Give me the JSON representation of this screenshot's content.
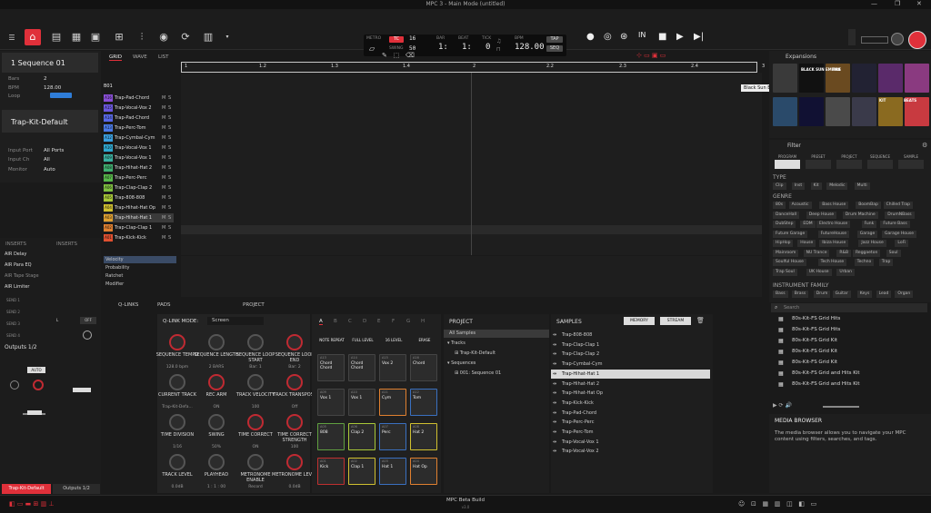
{
  "window": {
    "title": "MPC 3 - Main Mode (untitled)",
    "status": "MPC Beta Build",
    "status_sub": "v3.0"
  },
  "transport": {
    "metro_label": "METRO",
    "tc_label": "TC",
    "tc_value": "16",
    "swing_label": "SWING",
    "swing_value": "50",
    "bar_label": "BAR",
    "bar_value": "1:",
    "beat_label": "BEAT",
    "beat_value": "1:",
    "tick_label": "TICK",
    "tick_value": "0",
    "bpm_label": "BPM",
    "bpm_value": "128.00",
    "tap_label": "TAP",
    "seq_label": "SEQ"
  },
  "sequence": {
    "name": "1 Sequence 01",
    "bars_label": "Bars",
    "bars_value": "2",
    "bpm_label": "BPM",
    "bpm_value": "128.00",
    "loop_label": "Loop"
  },
  "track": {
    "name": "Trap-Kit-Default",
    "input_port_label": "Input Port",
    "input_port_value": "All Ports",
    "input_ch_label": "Input Ch",
    "input_ch_value": "All",
    "monitor_label": "Monitor",
    "monitor_value": "Auto"
  },
  "inserts": {
    "header_left": "INSERTS",
    "header_right": "INSERTS",
    "slots": [
      "AIR Delay",
      "AIR Para EQ",
      "AIR Tape Stage",
      "AIR Limiter"
    ],
    "sends": [
      "SEND 1",
      "SEND 2",
      "SEND 3",
      "SEND 4"
    ],
    "outputs": "Outputs 1/2",
    "auto": "AUTO",
    "bottom_left": "Trap-Kit-Default",
    "bottom_right": "Outputs 1/2"
  },
  "grid_tabs": [
    "GRID",
    "WAVE",
    "LIST"
  ],
  "grid_header_row": "B01",
  "tracks": [
    {
      "pad": "A16",
      "name": "Trap-Pad-Chord",
      "color": "#8a4fd8"
    },
    {
      "pad": "A15",
      "name": "Trap-Vocal-Vox 2",
      "color": "#6c58e0"
    },
    {
      "pad": "A14",
      "name": "Trap-Pad-Chord",
      "color": "#5868e8"
    },
    {
      "pad": "A13",
      "name": "Trap-Perc-Tom",
      "color": "#4a7ae8"
    },
    {
      "pad": "A12",
      "name": "Trap-Cymbal-Cym",
      "color": "#3aa0e0"
    },
    {
      "pad": "A10",
      "name": "Trap-Vocal-Vox 1",
      "color": "#2fa8d0"
    },
    {
      "pad": "A09",
      "name": "Trap-Vocal-Vox 1",
      "color": "#3ab0a0"
    },
    {
      "pad": "A08",
      "name": "Trap-Hihat-Hat 2",
      "color": "#40b070"
    },
    {
      "pad": "A07",
      "name": "Trap-Perc-Perc",
      "color": "#58b84a"
    },
    {
      "pad": "A06",
      "name": "Trap-Clap-Clap 2",
      "color": "#80c040"
    },
    {
      "pad": "A05",
      "name": "Trap-808-808",
      "color": "#a8c838"
    },
    {
      "pad": "A04",
      "name": "Trap-Hihat-Hat Op",
      "color": "#d0c030"
    },
    {
      "pad": "A03",
      "name": "Trap-Hihat-Hat 1",
      "color": "#e0a030"
    },
    {
      "pad": "A02",
      "name": "Trap-Clap-Clap 1",
      "color": "#e08030"
    },
    {
      "pad": "A01",
      "name": "Trap-Kick-Kick",
      "color": "#e05030"
    }
  ],
  "ruler": [
    "1",
    "1.2",
    "1.3",
    "1.4",
    "2",
    "2.2",
    "2.3",
    "2.4",
    "3"
  ],
  "tooltip": "Black Sun Empire",
  "lanes": [
    "Velocity",
    "Probability",
    "Ratchet",
    "Modifier"
  ],
  "bottom_tabs": {
    "qlinks": "Q-LINKS",
    "pads": "PADS",
    "project": "PROJECT"
  },
  "qlink": {
    "mode_label": "Q-LINK MODE:",
    "mode_value": "Screen",
    "knobs": [
      {
        "label": "SEQUENCE TEMPO",
        "value": "128.0 bpm"
      },
      {
        "label": "SEQUENCE LENGTH",
        "value": "2 BARS"
      },
      {
        "label": "SEQUENCE LOOP START",
        "value": "Bar: 1"
      },
      {
        "label": "SEQUENCE LOOP END",
        "value": "Bar: 2"
      },
      {
        "label": "CURRENT TRACK",
        "value": "Trap-Kit-Defa..."
      },
      {
        "label": "REC ARM",
        "value": "ON"
      },
      {
        "label": "TRACK VELOCITY",
        "value": "100"
      },
      {
        "label": "TRACK TRANSPOSE",
        "value": "Off"
      },
      {
        "label": "TIME DIVISION",
        "value": "1/16"
      },
      {
        "label": "SWING",
        "value": "50%"
      },
      {
        "label": "TIME CORRECT",
        "value": "ON"
      },
      {
        "label": "TIME CORRECT STRENGTH",
        "value": "100"
      },
      {
        "label": "TRACK LEVEL",
        "value": "0.0dB"
      },
      {
        "label": "PLAYHEAD",
        "value": "1 : 1 : 00"
      },
      {
        "label": "METRONOME ENABLE",
        "value": "Record"
      },
      {
        "label": "METRONOME LEVEL",
        "value": "0.0dB"
      }
    ]
  },
  "pads": {
    "banks": [
      "A",
      "B",
      "C",
      "D",
      "E",
      "F",
      "G",
      "H"
    ],
    "buttons": [
      "NOTE REPEAT",
      "FULL LEVEL",
      "16 LEVEL",
      "ERASE"
    ],
    "items": [
      {
        "num": "A13",
        "name": "Chord Chord",
        "color": "#444"
      },
      {
        "num": "A14",
        "name": "Chord Chord",
        "color": "#444"
      },
      {
        "num": "A15",
        "name": "Vox 2",
        "color": "#444"
      },
      {
        "num": "A16",
        "name": "Chord",
        "color": "#444"
      },
      {
        "num": "A09",
        "name": "Vox 1",
        "color": "#444"
      },
      {
        "num": "A10",
        "name": "Vox 1",
        "color": "#444"
      },
      {
        "num": "A11",
        "name": "Cym",
        "color": "#e08030"
      },
      {
        "num": "A12",
        "name": "Tom",
        "color": "#3a70c0"
      },
      {
        "num": "A05",
        "name": "808",
        "color": "#60a040"
      },
      {
        "num": "A06",
        "name": "Clap 2",
        "color": "#a8c838"
      },
      {
        "num": "A07",
        "name": "Perc",
        "color": "#3a70c0"
      },
      {
        "num": "A08",
        "name": "Hat 2",
        "color": "#d0c030"
      },
      {
        "num": "A01",
        "name": "Kick",
        "color": "#c03030"
      },
      {
        "num": "A02",
        "name": "Clap 1",
        "color": "#d0c030"
      },
      {
        "num": "A03",
        "name": "Hat 1",
        "color": "#3a70c0"
      },
      {
        "num": "A04",
        "name": "Hat Op",
        "color": "#e08030"
      }
    ]
  },
  "project": {
    "title": "PROJECT",
    "all_samples": "All Samples",
    "tracks": "Tracks",
    "track_item": "Trap-Kit-Default",
    "sequences": "Sequences",
    "seq_item": "001: Sequence 01"
  },
  "samples": {
    "title": "SAMPLES",
    "memory": "MEMORY",
    "stream": "STREAM",
    "items": [
      "Trap-808-808",
      "Trap-Clap-Clap 1",
      "Trap-Clap-Clap 2",
      "Trap-Cymbal-Cym",
      "Trap-Hihat-Hat 1",
      "Trap-Hihat-Hat 2",
      "Trap-Hihat-Hat Op",
      "Trap-Kick-Kick",
      "Trap-Pad-Chord",
      "Trap-Perc-Perc",
      "Trap-Perc-Tom",
      "Trap-Vocal-Vox 1",
      "Trap-Vocal-Vox 2"
    ],
    "selected_index": 4
  },
  "browser": {
    "expansions_title": "Expansions",
    "filter_title": "Filter",
    "filter_tabs": [
      "PROGRAM",
      "PRESET",
      "PROJECT",
      "SEQUENCE",
      "SAMPLE"
    ],
    "type_label": "TYPE",
    "types": [
      "Clip",
      "Inst",
      "Kit",
      "Melodic",
      "Multi"
    ],
    "genre_label": "GENRE",
    "genres": [
      "80s",
      "Acoustic",
      "Bass House",
      "BoomBap",
      "Chilled Trap",
      "DanceHall",
      "Deep House",
      "Drum Machine",
      "DrumNBass",
      "DubStep",
      "EDM",
      "Electro House",
      "Funk",
      "Future Bass",
      "Future Garage",
      "FutureHouse",
      "Garage",
      "Garage House",
      "HipHop",
      "House",
      "Ibiza House",
      "Jazz House",
      "LoFi",
      "Mainroom",
      "NU Trance",
      "R&B",
      "Reggaeton",
      "Soul",
      "Soulful House",
      "Tech House",
      "Techno",
      "Trap",
      "Trap Soul",
      "UK House",
      "Urban"
    ],
    "family_label": "INSTRUMENT FAMILY",
    "families": [
      "Bass",
      "Brass",
      "Drum",
      "Guitar",
      "Keys",
      "Lead",
      "Organ"
    ],
    "search_placeholder": "Search",
    "results": [
      "80s-Kit-FS Grid Hits",
      "80s-Kit-FS Grid Hits",
      "80s-Kit-FS Grid Kit",
      "80s-Kit-FS Grid Kit",
      "80s-Kit-FS Grid Kit",
      "80s-Kit-FS Grid and Hits Kit",
      "80s-Kit-FS Grid and Hits Kit"
    ],
    "media_title": "MEDIA BROWSER",
    "media_desc": "The media browser allows you to navigate your MPC content using filters, searches, and tags.",
    "expansion_badges": [
      "BLACK SUN EMPIRE",
      "808",
      "BEATS",
      "KIT"
    ]
  }
}
